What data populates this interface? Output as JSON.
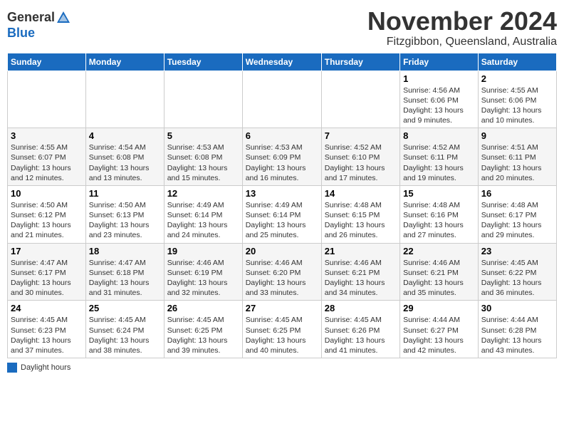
{
  "header": {
    "logo_line1": "General",
    "logo_line2": "Blue",
    "month": "November 2024",
    "location": "Fitzgibbon, Queensland, Australia"
  },
  "days_of_week": [
    "Sunday",
    "Monday",
    "Tuesday",
    "Wednesday",
    "Thursday",
    "Friday",
    "Saturday"
  ],
  "weeks": [
    [
      {
        "day": "",
        "info": ""
      },
      {
        "day": "",
        "info": ""
      },
      {
        "day": "",
        "info": ""
      },
      {
        "day": "",
        "info": ""
      },
      {
        "day": "",
        "info": ""
      },
      {
        "day": "1",
        "info": "Sunrise: 4:56 AM\nSunset: 6:06 PM\nDaylight: 13 hours and 9 minutes."
      },
      {
        "day": "2",
        "info": "Sunrise: 4:55 AM\nSunset: 6:06 PM\nDaylight: 13 hours and 10 minutes."
      }
    ],
    [
      {
        "day": "3",
        "info": "Sunrise: 4:55 AM\nSunset: 6:07 PM\nDaylight: 13 hours and 12 minutes."
      },
      {
        "day": "4",
        "info": "Sunrise: 4:54 AM\nSunset: 6:08 PM\nDaylight: 13 hours and 13 minutes."
      },
      {
        "day": "5",
        "info": "Sunrise: 4:53 AM\nSunset: 6:08 PM\nDaylight: 13 hours and 15 minutes."
      },
      {
        "day": "6",
        "info": "Sunrise: 4:53 AM\nSunset: 6:09 PM\nDaylight: 13 hours and 16 minutes."
      },
      {
        "day": "7",
        "info": "Sunrise: 4:52 AM\nSunset: 6:10 PM\nDaylight: 13 hours and 17 minutes."
      },
      {
        "day": "8",
        "info": "Sunrise: 4:52 AM\nSunset: 6:11 PM\nDaylight: 13 hours and 19 minutes."
      },
      {
        "day": "9",
        "info": "Sunrise: 4:51 AM\nSunset: 6:11 PM\nDaylight: 13 hours and 20 minutes."
      }
    ],
    [
      {
        "day": "10",
        "info": "Sunrise: 4:50 AM\nSunset: 6:12 PM\nDaylight: 13 hours and 21 minutes."
      },
      {
        "day": "11",
        "info": "Sunrise: 4:50 AM\nSunset: 6:13 PM\nDaylight: 13 hours and 23 minutes."
      },
      {
        "day": "12",
        "info": "Sunrise: 4:49 AM\nSunset: 6:14 PM\nDaylight: 13 hours and 24 minutes."
      },
      {
        "day": "13",
        "info": "Sunrise: 4:49 AM\nSunset: 6:14 PM\nDaylight: 13 hours and 25 minutes."
      },
      {
        "day": "14",
        "info": "Sunrise: 4:48 AM\nSunset: 6:15 PM\nDaylight: 13 hours and 26 minutes."
      },
      {
        "day": "15",
        "info": "Sunrise: 4:48 AM\nSunset: 6:16 PM\nDaylight: 13 hours and 27 minutes."
      },
      {
        "day": "16",
        "info": "Sunrise: 4:48 AM\nSunset: 6:17 PM\nDaylight: 13 hours and 29 minutes."
      }
    ],
    [
      {
        "day": "17",
        "info": "Sunrise: 4:47 AM\nSunset: 6:17 PM\nDaylight: 13 hours and 30 minutes."
      },
      {
        "day": "18",
        "info": "Sunrise: 4:47 AM\nSunset: 6:18 PM\nDaylight: 13 hours and 31 minutes."
      },
      {
        "day": "19",
        "info": "Sunrise: 4:46 AM\nSunset: 6:19 PM\nDaylight: 13 hours and 32 minutes."
      },
      {
        "day": "20",
        "info": "Sunrise: 4:46 AM\nSunset: 6:20 PM\nDaylight: 13 hours and 33 minutes."
      },
      {
        "day": "21",
        "info": "Sunrise: 4:46 AM\nSunset: 6:21 PM\nDaylight: 13 hours and 34 minutes."
      },
      {
        "day": "22",
        "info": "Sunrise: 4:46 AM\nSunset: 6:21 PM\nDaylight: 13 hours and 35 minutes."
      },
      {
        "day": "23",
        "info": "Sunrise: 4:45 AM\nSunset: 6:22 PM\nDaylight: 13 hours and 36 minutes."
      }
    ],
    [
      {
        "day": "24",
        "info": "Sunrise: 4:45 AM\nSunset: 6:23 PM\nDaylight: 13 hours and 37 minutes."
      },
      {
        "day": "25",
        "info": "Sunrise: 4:45 AM\nSunset: 6:24 PM\nDaylight: 13 hours and 38 minutes."
      },
      {
        "day": "26",
        "info": "Sunrise: 4:45 AM\nSunset: 6:25 PM\nDaylight: 13 hours and 39 minutes."
      },
      {
        "day": "27",
        "info": "Sunrise: 4:45 AM\nSunset: 6:25 PM\nDaylight: 13 hours and 40 minutes."
      },
      {
        "day": "28",
        "info": "Sunrise: 4:45 AM\nSunset: 6:26 PM\nDaylight: 13 hours and 41 minutes."
      },
      {
        "day": "29",
        "info": "Sunrise: 4:44 AM\nSunset: 6:27 PM\nDaylight: 13 hours and 42 minutes."
      },
      {
        "day": "30",
        "info": "Sunrise: 4:44 AM\nSunset: 6:28 PM\nDaylight: 13 hours and 43 minutes."
      }
    ]
  ],
  "legend": {
    "color_label": "Daylight hours"
  }
}
